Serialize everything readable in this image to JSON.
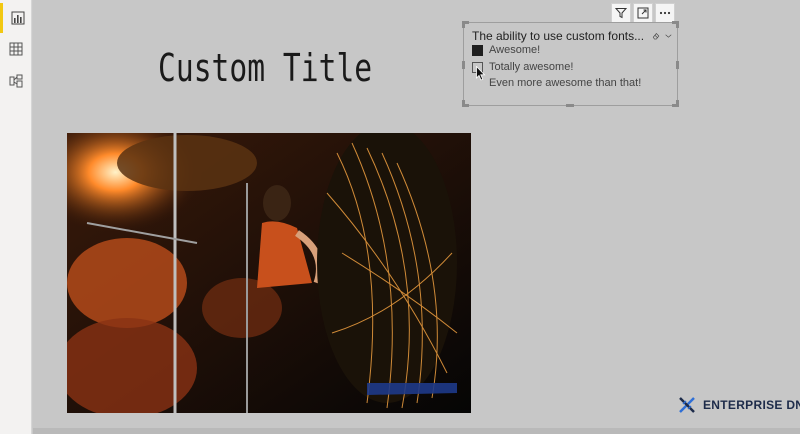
{
  "nav": {
    "items": [
      {
        "name": "report-view",
        "icon": "bar-chart-icon",
        "active": true
      },
      {
        "name": "data-view",
        "icon": "table-icon",
        "active": false
      },
      {
        "name": "model-view",
        "icon": "model-icon",
        "active": false
      }
    ]
  },
  "report": {
    "title": "Custom Title"
  },
  "slicer": {
    "header": "The ability to use custom fonts...",
    "items": [
      {
        "label": "Awesome!",
        "checked": true
      },
      {
        "label": "Totally awesome!",
        "checked": false
      },
      {
        "label": "Even more awesome than that!",
        "checked": null
      }
    ]
  },
  "toolbar": {
    "icons": [
      "filter-icon",
      "focus-mode-icon",
      "more-options-icon"
    ]
  },
  "logo": {
    "text": "ENTERPRISE DNA",
    "color": "#1d2b4a",
    "accent": "#2f6fd6"
  }
}
